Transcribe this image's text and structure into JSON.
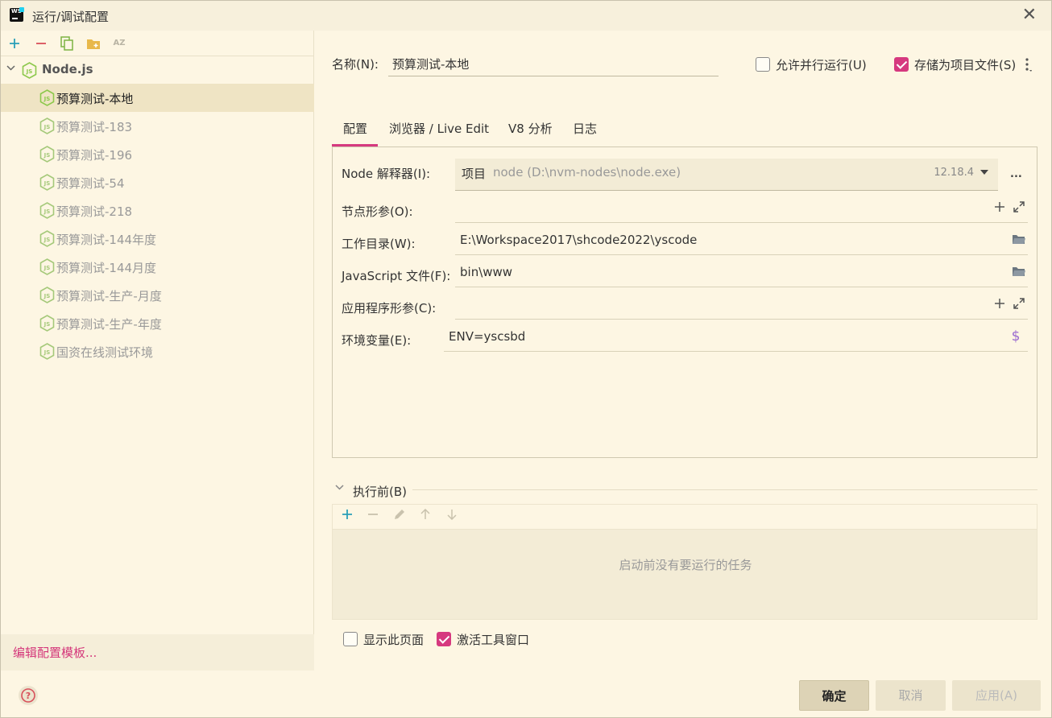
{
  "window": {
    "title": "运行/调试配置"
  },
  "left": {
    "toolbar": {
      "add_icon": "plus-icon",
      "remove_icon": "minus-icon",
      "copy_icon": "copy-icon",
      "folder_icon": "new-folder-icon",
      "sort_label": "AZ"
    },
    "root": {
      "label": "Node.js"
    },
    "items": [
      {
        "label": "预算测试-本地",
        "selected": true
      },
      {
        "label": "预算测试-183"
      },
      {
        "label": "预算测试-196"
      },
      {
        "label": "预算测试-54"
      },
      {
        "label": "预算测试-218"
      },
      {
        "label": "预算测试-144年度"
      },
      {
        "label": "预算测试-144月度"
      },
      {
        "label": "预算测试-生产-月度"
      },
      {
        "label": "预算测试-生产-年度"
      },
      {
        "label": "国资在线测试环境"
      }
    ],
    "edit_template": "编辑配置模板..."
  },
  "header": {
    "name_label": "名称(N):",
    "name_value": "预算测试-本地",
    "parallel_label": "允许并行运行(U)",
    "parallel_checked": false,
    "store_label": "存储为项目文件(S)",
    "store_checked": true
  },
  "tabs": [
    {
      "label": "配置",
      "active": true
    },
    {
      "label": "浏览器 / Live Edit"
    },
    {
      "label": "V8 分析"
    },
    {
      "label": "日志"
    }
  ],
  "config": {
    "interpreter_label": "Node 解释器(I):",
    "interpreter_tag": "项目",
    "interpreter_path": "node (D:\\nvm-nodes\\node.exe)",
    "interpreter_version": "12.18.4",
    "more_label": "...",
    "node_params_label": "节点形参(O):",
    "node_params_value": "",
    "workdir_label": "工作目录(W):",
    "workdir_value": "E:\\Workspace2017\\shcode2022\\yscode",
    "jsfile_label": "JavaScript 文件(F):",
    "jsfile_value": "bin\\www",
    "app_params_label": "应用程序形参(C):",
    "app_params_value": "",
    "env_label": "环境变量(E):",
    "env_value": "ENV=yscsbd"
  },
  "before_launch": {
    "label": "执行前(B)",
    "empty_message": "启动前没有要运行的任务"
  },
  "options": {
    "show_page_label": "显示此页面",
    "show_page_checked": false,
    "activate_label": "激活工具窗口",
    "activate_checked": true
  },
  "buttons": {
    "ok": "确定",
    "cancel": "取消",
    "apply": "应用(A)"
  },
  "colors": {
    "background": "#fdf6e3",
    "accent": "#d6397f",
    "add": "#2a9fb8",
    "remove": "#d8505a",
    "node_green": "#8cc84b"
  }
}
